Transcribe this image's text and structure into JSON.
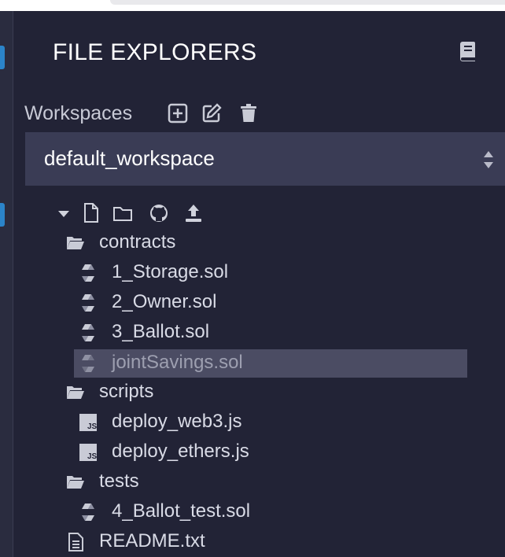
{
  "panel": {
    "title": "FILE EXPLORERS"
  },
  "workspaces": {
    "label": "Workspaces",
    "selected": "default_workspace"
  },
  "tree": [
    {
      "label": "contracts",
      "type": "folder-open"
    },
    {
      "label": "1_Storage.sol",
      "type": "solidity-file"
    },
    {
      "label": "2_Owner.sol",
      "type": "solidity-file"
    },
    {
      "label": "3_Ballot.sol",
      "type": "solidity-file"
    },
    {
      "label": "jointSavings.sol",
      "type": "solidity-file",
      "selected": true
    },
    {
      "label": "scripts",
      "type": "folder-open"
    },
    {
      "label": "deploy_web3.js",
      "type": "js-file"
    },
    {
      "label": "deploy_ethers.js",
      "type": "js-file"
    },
    {
      "label": "tests",
      "type": "folder-open"
    },
    {
      "label": "4_Ballot_test.sol",
      "type": "solidity-file"
    },
    {
      "label": "README.txt",
      "type": "text-file"
    }
  ],
  "icons": {
    "title": "book-icon",
    "workspace_actions": [
      "plus-square-icon",
      "edit-icon",
      "trash-icon"
    ],
    "tree_tools": [
      "caret-down-icon",
      "new-file-icon",
      "new-folder-icon",
      "github-icon",
      "upload-icon"
    ]
  },
  "colors": {
    "background": "#222336",
    "select": "#3a3c55",
    "selected_row": "#4b4c63",
    "accent": "#2b84c9",
    "text": "#d9dbe6"
  }
}
